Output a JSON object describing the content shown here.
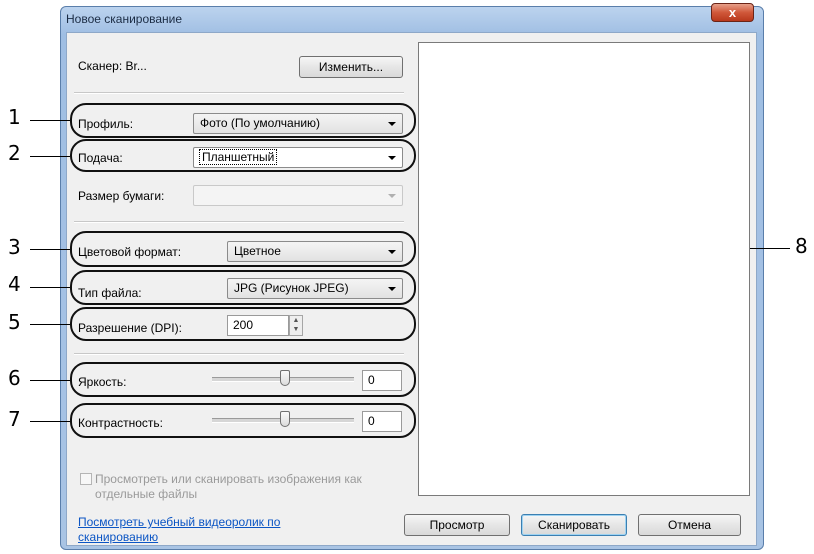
{
  "window": {
    "title": "Новое сканирование",
    "close_label": "x"
  },
  "scanner": {
    "label": "Сканер: Br...",
    "change_button": "Изменить..."
  },
  "profile": {
    "label": "Профиль:",
    "value": "Фото (По умолчанию)"
  },
  "source": {
    "label": "Подача:",
    "value": "Планшетный"
  },
  "paper_size": {
    "label": "Размер бумаги:",
    "value": ""
  },
  "color_format": {
    "label": "Цветовой формат:",
    "value": "Цветное"
  },
  "file_type": {
    "label": "Тип файла:",
    "value": "JPG (Рисунок JPEG)"
  },
  "resolution": {
    "label": "Разрешение (DPI):",
    "value": "200"
  },
  "brightness": {
    "label": "Яркость:",
    "value": "0"
  },
  "contrast": {
    "label": "Контрастность:",
    "value": "0"
  },
  "separate_files": {
    "label_line1": "Просмотреть или сканировать изображения как",
    "label_line2": "отдельные файлы",
    "checked": false
  },
  "help_link": {
    "line1": "Посмотреть учебный видеоролик по",
    "line2": "сканированию"
  },
  "buttons": {
    "preview": "Просмотр",
    "scan": "Сканировать",
    "cancel": "Отмена"
  },
  "callouts": [
    "1",
    "2",
    "3",
    "4",
    "5",
    "6",
    "7",
    "8"
  ]
}
